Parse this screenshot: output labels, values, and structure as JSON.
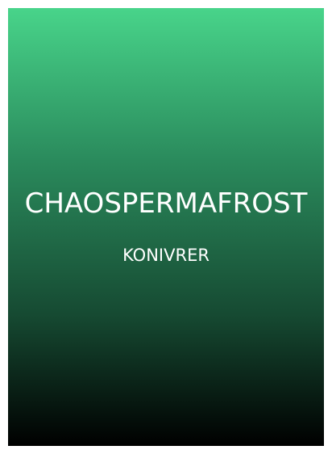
{
  "cover": {
    "title": "CHAOSPERMAFROST",
    "subtitle": "KONIVRER"
  },
  "colors": {
    "gradient_top": "#48d48a",
    "gradient_bottom": "#000000",
    "text": "#ffffff",
    "background": "#ffffff"
  }
}
